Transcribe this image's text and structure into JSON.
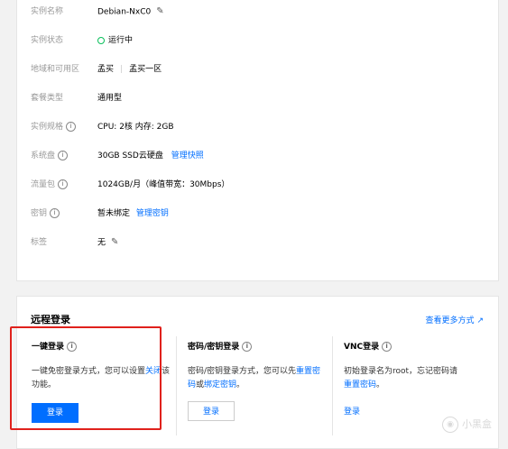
{
  "instance": {
    "rows": [
      {
        "label": "实例名称",
        "value": "Debian-NxC0"
      },
      {
        "label": "实例状态",
        "value": "运行中"
      },
      {
        "label": "地域和可用区",
        "region": "孟买",
        "zone": "孟买一区"
      },
      {
        "label": "套餐类型",
        "value": "通用型"
      },
      {
        "label": "实例规格",
        "value": "CPU: 2核 内存: 2GB"
      },
      {
        "label": "系统盘",
        "value": "30GB SSD云硬盘",
        "link": "管理快照"
      },
      {
        "label": "流量包",
        "value": "1024GB/月（峰值带宽：30Mbps）"
      },
      {
        "label": "密钥",
        "value": "暂未绑定",
        "link": "管理密钥"
      },
      {
        "label": "标签",
        "value": "无"
      }
    ],
    "region_separator": "|"
  },
  "remote": {
    "title": "远程登录",
    "more_link": "查看更多方式",
    "one_click": {
      "title": "一键登录",
      "desc_prefix": "一键免密登录方式，您可以设置",
      "desc_link": "关闭",
      "desc_suffix": "该功能。",
      "button": "登录"
    },
    "password": {
      "title": "密码/密钥登录",
      "desc_prefix": "密码/密钥登录方式，您可以先",
      "link1": "重置密码",
      "mid": "或",
      "link2": "绑定密钥",
      "end": "。",
      "button": "登录"
    },
    "vnc": {
      "title": "VNC登录",
      "desc_prefix": "初始登录名为root，忘记密码请",
      "link": "重置密码",
      "end": "。",
      "button": "登录"
    }
  },
  "icons": {
    "info": "info-icon",
    "edit": "pencil-icon",
    "external": "external-link-icon",
    "status": "status-dot-icon"
  },
  "colors": {
    "link": "#006eff",
    "primary_button": "#006eff",
    "running": "#0abf5b",
    "highlight": "#e0211c"
  },
  "watermark": "小黑盒"
}
